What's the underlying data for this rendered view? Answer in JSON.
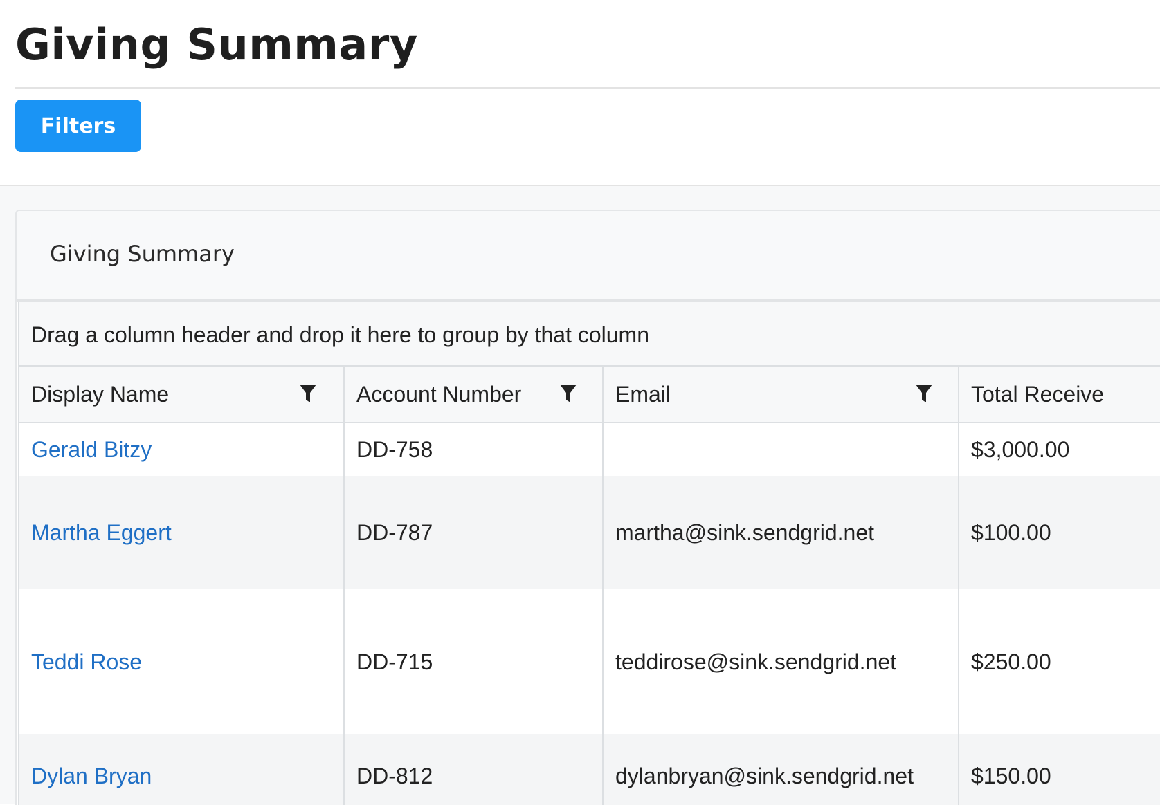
{
  "page": {
    "title": "Giving Summary",
    "filters_button_label": "Filters"
  },
  "card": {
    "title": "Giving Summary"
  },
  "grid": {
    "group_panel_text": "Drag a column header and drop it here to group by that column",
    "columns": [
      {
        "label": "Display Name",
        "filter_icon": "funnel-icon"
      },
      {
        "label": "Account Number",
        "filter_icon": "funnel-icon"
      },
      {
        "label": "Email",
        "filter_icon": "funnel-icon"
      },
      {
        "label": "Total Receive"
      }
    ],
    "rows": [
      {
        "display_name": "Gerald Bitzy",
        "account_number": "DD-758",
        "email": "",
        "total_received": "$3,000.00"
      },
      {
        "display_name": "Martha Eggert",
        "account_number": "DD-787",
        "email": "martha@sink.sendgrid.net",
        "total_received": "$100.00"
      },
      {
        "display_name": "Teddi Rose",
        "account_number": "DD-715",
        "email": "teddirose@sink.sendgrid.net",
        "total_received": "$250.00"
      },
      {
        "display_name": "Dylan Bryan",
        "account_number": "DD-812",
        "email": "dylanbryan@sink.sendgrid.net",
        "total_received": "$150.00"
      }
    ]
  },
  "colors": {
    "primary_button": "#1a94f5",
    "link": "#1f6fc5",
    "row_alt_background": "#f4f5f6",
    "border": "#dcdfe2"
  }
}
